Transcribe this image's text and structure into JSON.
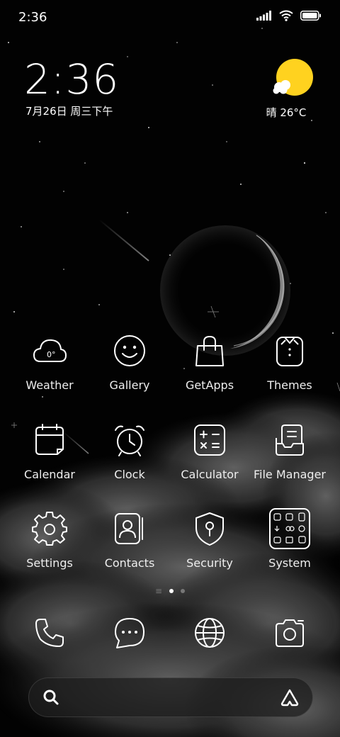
{
  "status_bar": {
    "time": "2:36",
    "icons": [
      "signal-icon",
      "wifi-icon",
      "battery-icon"
    ]
  },
  "clock_widget": {
    "time": "2:36",
    "date": "7月26日 周三下午"
  },
  "weather_widget": {
    "condition_temp": "晴 26°C",
    "icon": "sunny-icon"
  },
  "apps": [
    {
      "label": "Weather",
      "icon": "weather-cloud-icon"
    },
    {
      "label": "Gallery",
      "icon": "smiley-icon"
    },
    {
      "label": "GetApps",
      "icon": "shopping-bag-icon"
    },
    {
      "label": "Themes",
      "icon": "shirt-icon"
    },
    {
      "label": "Calendar",
      "icon": "calendar-icon"
    },
    {
      "label": "Clock",
      "icon": "alarm-clock-icon"
    },
    {
      "label": "Calculator",
      "icon": "calculator-icon"
    },
    {
      "label": "File Manager",
      "icon": "folder-icon"
    },
    {
      "label": "Settings",
      "icon": "gear-icon"
    },
    {
      "label": "Contacts",
      "icon": "contacts-icon"
    },
    {
      "label": "Security",
      "icon": "shield-icon"
    },
    {
      "label": "System",
      "icon": "folder-grid-icon"
    }
  ],
  "dock": [
    {
      "icon": "phone-icon"
    },
    {
      "icon": "message-icon"
    },
    {
      "icon": "globe-icon"
    },
    {
      "icon": "camera-icon"
    }
  ],
  "page_indicator": {
    "pages": 2,
    "active": 0
  },
  "search_bar": {
    "icon": "search-icon",
    "assistant_icon": "assistant-icon"
  },
  "colors": {
    "sun": "#FFD21F",
    "background": "#000000",
    "text": "#FFFFFF"
  }
}
